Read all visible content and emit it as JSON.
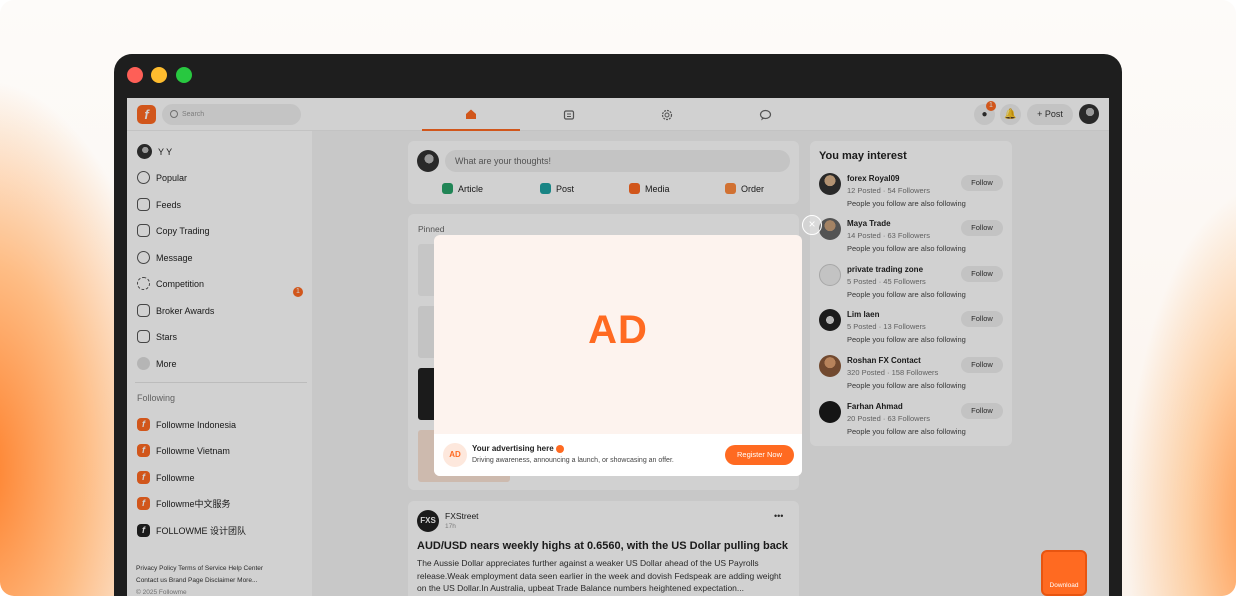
{
  "topbar": {
    "search_placeholder": "Search",
    "notification_badge": "1",
    "post_label": "Post"
  },
  "sidebar": {
    "user_name": "Y Y",
    "items": [
      {
        "label": "Popular"
      },
      {
        "label": "Feeds"
      },
      {
        "label": "Copy Trading"
      },
      {
        "label": "Message",
        "badge": "1"
      },
      {
        "label": "Competition"
      },
      {
        "label": "Broker Awards"
      },
      {
        "label": "Stars"
      },
      {
        "label": "More"
      }
    ],
    "following_header": "Following",
    "following": [
      {
        "label": "Followme Indonesia"
      },
      {
        "label": "Followme Vietnam"
      },
      {
        "label": "Followme"
      },
      {
        "label": "Followme中文服务"
      },
      {
        "label": "FOLLOWME 设计团队"
      }
    ],
    "footer_line1": "Privacy Policy   Terms of Service   Help Center",
    "footer_line2": "Contact us   Brand Page   Disclaimer   More...",
    "footer_line3": "© 2025 Followme"
  },
  "composer": {
    "placeholder": "What are your thoughts!",
    "actions": [
      {
        "label": "Article",
        "color": "#29a36a"
      },
      {
        "label": "Post",
        "color": "#1fa3a3"
      },
      {
        "label": "Media",
        "color": "#ff6a21"
      },
      {
        "label": "Order",
        "color": "#ff8a3d"
      }
    ]
  },
  "pinned": {
    "header": "Pinned"
  },
  "article": {
    "author": "FXStreet",
    "time": "17h",
    "title": "AUD/USD nears weekly highs at 0.6560, with the US Dollar pulling back",
    "body": "The Aussie Dollar appreciates further against a weaker US Dollar ahead of the US Payrolls release.Weak employment data seen earlier in the week and dovish Fedspeak are adding weight on the US Dollar.In Australia, upbeat Trade Balance numbers heightened expectation...",
    "more_label": "•••"
  },
  "recommend": {
    "title": "You may interest",
    "follow_label": "Follow",
    "note": "People you follow are also following",
    "users": [
      {
        "name": "forex Royal09",
        "stats": "12 Posted  ·  54 Followers"
      },
      {
        "name": "Maya Trade",
        "stats": "14 Posted  ·  63 Followers"
      },
      {
        "name": "private trading zone",
        "stats": "5 Posted  ·  45 Followers"
      },
      {
        "name": "Lim laen",
        "stats": "5 Posted  ·  13 Followers"
      },
      {
        "name": "Roshan FX Contact",
        "stats": "320 Posted  ·  158 Followers"
      },
      {
        "name": "Farhan Ahmad",
        "stats": "20 Posted  ·  63 Followers"
      }
    ]
  },
  "ad": {
    "big_text": "AD",
    "logo_text": "AD",
    "title": "Your advertising here",
    "description": "Driving awareness, announcing a launch, or showcasing an offer.",
    "cta": "Register Now",
    "close": "×"
  },
  "download_label": "Download"
}
